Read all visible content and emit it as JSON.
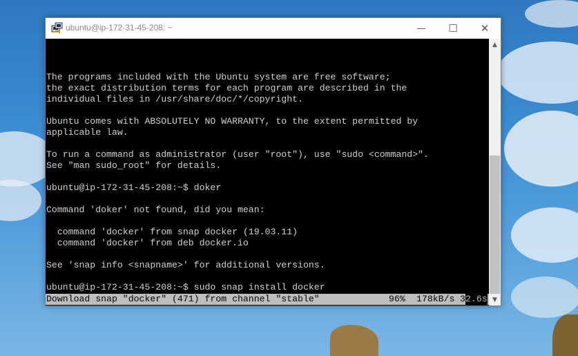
{
  "window": {
    "title": "ubuntu@ip-172-31-45-208: ~",
    "controls": {
      "minimize": "—",
      "maximize": "☐",
      "close": "✕"
    }
  },
  "terminal": {
    "lines": [
      "",
      "",
      "",
      "The programs included with the Ubuntu system are free software;",
      "the exact distribution terms for each program are described in the",
      "individual files in /usr/share/doc/*/copyright.",
      "",
      "Ubuntu comes with ABSOLUTELY NO WARRANTY, to the extent permitted by",
      "applicable law.",
      "",
      "To run a command as administrator (user \"root\"), use \"sudo <command>\".",
      "See \"man sudo_root\" for details.",
      "",
      "ubuntu@ip-172-31-45-208:~$ doker",
      "",
      "Command 'doker' not found, did you mean:",
      "",
      "  command 'docker' from snap docker (19.03.11)",
      "  command 'docker' from deb docker.io",
      "",
      "See 'snap info <snapname>' for additional versions.",
      "",
      "ubuntu@ip-172-31-45-208:~$ sudo snap install docker"
    ],
    "status": {
      "message": "Download snap \"docker\" (471) from channel \"stable\"",
      "percent": "96%",
      "speed": "178kB/s",
      "eta_head": "3",
      "eta_tail": "2.6s"
    }
  },
  "scrollbar": {
    "up": "▲",
    "down": "▼"
  }
}
